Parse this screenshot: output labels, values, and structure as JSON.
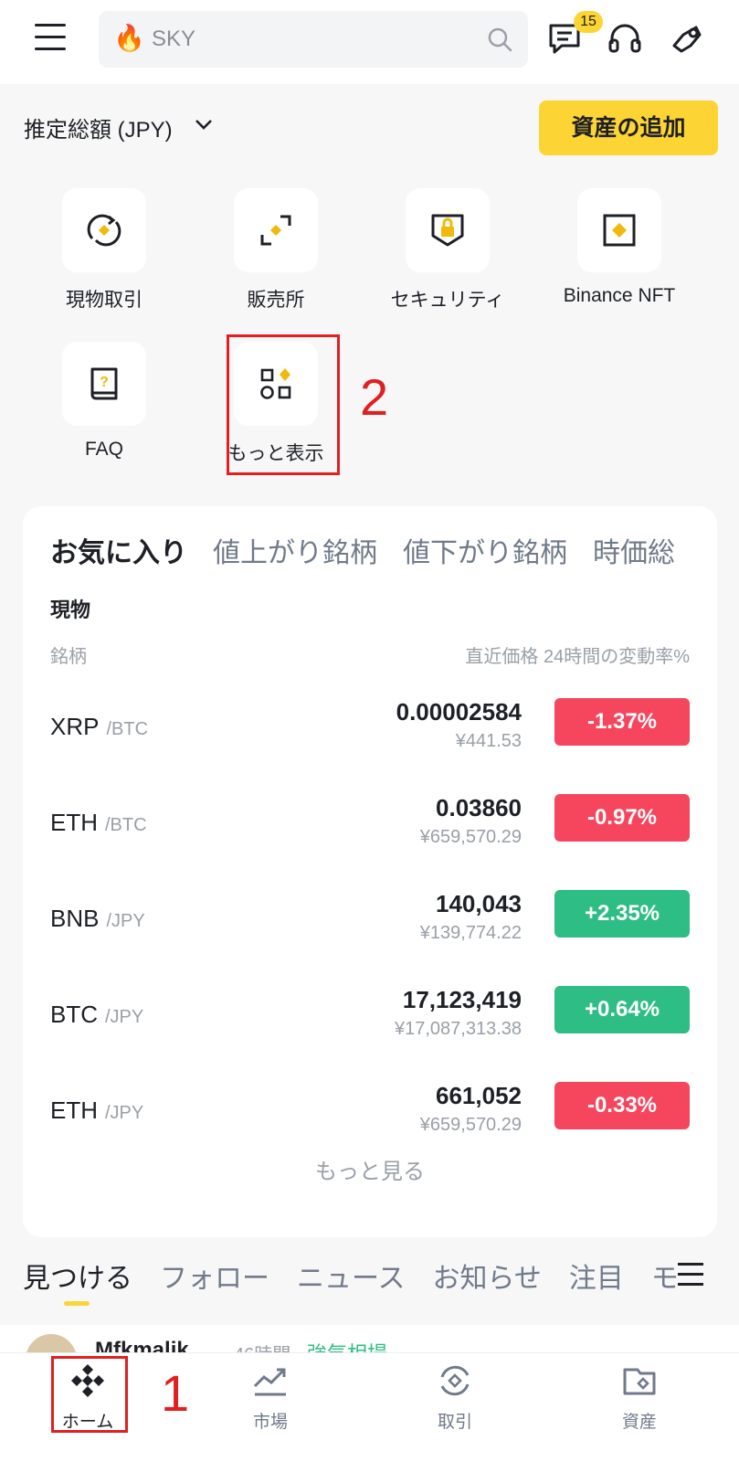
{
  "header": {
    "search_placeholder": "SKY",
    "search_prefix_icon": "fire-icon",
    "notification_count": "15"
  },
  "balance": {
    "label": "推定総額 (JPY)",
    "add_funds_label": "資産の追加"
  },
  "shortcuts": [
    {
      "label": "現物取引",
      "icon": "spot-trade-icon"
    },
    {
      "label": "販売所",
      "icon": "convert-icon"
    },
    {
      "label": "セキュリティ",
      "icon": "security-icon"
    },
    {
      "label": "Binance NFT",
      "icon": "nft-icon"
    },
    {
      "label": "FAQ",
      "icon": "faq-icon"
    },
    {
      "label": "もっと表示",
      "icon": "more-icon"
    }
  ],
  "annotations": {
    "first": "1",
    "second": "2"
  },
  "market": {
    "tabs": [
      "お気に入り",
      "値上がり銘柄",
      "値下がり銘柄",
      "時価総"
    ],
    "section": "現物",
    "col_pair": "銘柄",
    "col_price_change": "直近価格 24時間の変動率%",
    "rows": [
      {
        "base": "XRP",
        "quote": "/BTC",
        "price": "0.00002584",
        "fiat": "¥441.53",
        "change": "-1.37%",
        "color": "#f6465d"
      },
      {
        "base": "ETH",
        "quote": "/BTC",
        "price": "0.03860",
        "fiat": "¥659,570.29",
        "change": "-0.97%",
        "color": "#f6465d"
      },
      {
        "base": "BNB",
        "quote": "/JPY",
        "price": "140,043",
        "fiat": "¥139,774.22",
        "change": "+2.35%",
        "color": "#2ebd85"
      },
      {
        "base": "BTC",
        "quote": "/JPY",
        "price": "17,123,419",
        "fiat": "¥17,087,313.38",
        "change": "+0.64%",
        "color": "#2ebd85"
      },
      {
        "base": "ETH",
        "quote": "/JPY",
        "price": "661,052",
        "fiat": "¥659,570.29",
        "change": "-0.33%",
        "color": "#f6465d"
      }
    ],
    "more_label": "もっと見る"
  },
  "feed": {
    "tabs": [
      "見つける",
      "フォロー",
      "ニュース",
      "お知らせ",
      "注目",
      "モ"
    ],
    "peek": {
      "author": "Mfkmalik",
      "time": "46時間",
      "tag": "強気相場"
    }
  },
  "bottom_nav": [
    {
      "label": "ホーム",
      "icon": "binance-logo-icon"
    },
    {
      "label": "市場",
      "icon": "market-chart-icon"
    },
    {
      "label": "取引",
      "icon": "trade-icon"
    },
    {
      "label": "資産",
      "icon": "wallet-icon"
    }
  ],
  "colors": {
    "accent": "#fcd535",
    "down": "#f6465d",
    "up": "#2ebd85",
    "annotation": "#e02020"
  }
}
